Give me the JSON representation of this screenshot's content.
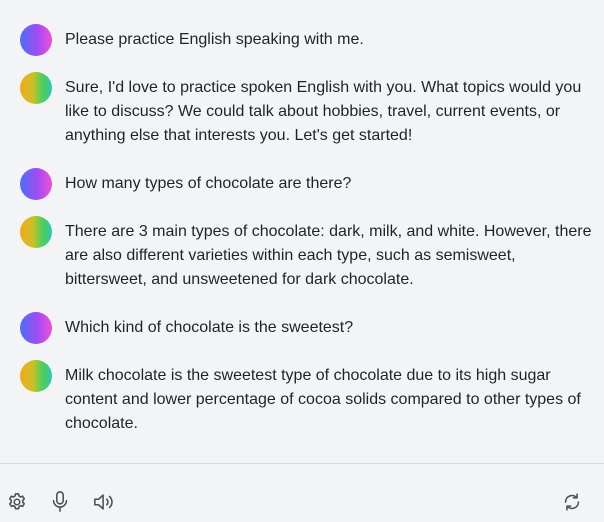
{
  "messages": [
    {
      "role": "user",
      "avatar_icon": "user-avatar-gradient",
      "text": "Please practice English speaking with me."
    },
    {
      "role": "assistant",
      "avatar_icon": "assistant-avatar-gradient",
      "text": "Sure, I'd love to practice spoken English with you. What topics would you\nlike to discuss? We could talk about hobbies, travel, current events, or\nanything else that interests you. Let's get started!"
    },
    {
      "role": "user",
      "avatar_icon": "user-avatar-gradient",
      "text": "How many types of chocolate are there?"
    },
    {
      "role": "assistant",
      "avatar_icon": "assistant-avatar-gradient",
      "text": "There are 3 main types of chocolate: dark, milk, and white. However, there\nare also different varieties within each type, such as semisweet,\nbittersweet, and unsweetened for dark chocolate."
    },
    {
      "role": "user",
      "avatar_icon": "user-avatar-gradient",
      "text": "Which kind of chocolate is the sweetest?"
    },
    {
      "role": "assistant",
      "avatar_icon": "assistant-avatar-gradient",
      "text": "Milk chocolate is the sweetest type of chocolate due to its high sugar\ncontent and lower percentage of cocoa solids compared to other types of\nchocolate."
    }
  ],
  "toolbar": {
    "icons": [
      "gear-icon",
      "microphone-icon",
      "speaker-icon",
      "refresh-icon"
    ]
  },
  "colors": {
    "background": "#f3f4f6",
    "text": "#1f2328",
    "icon": "#4b5058",
    "divider": "#d7d9dd"
  }
}
